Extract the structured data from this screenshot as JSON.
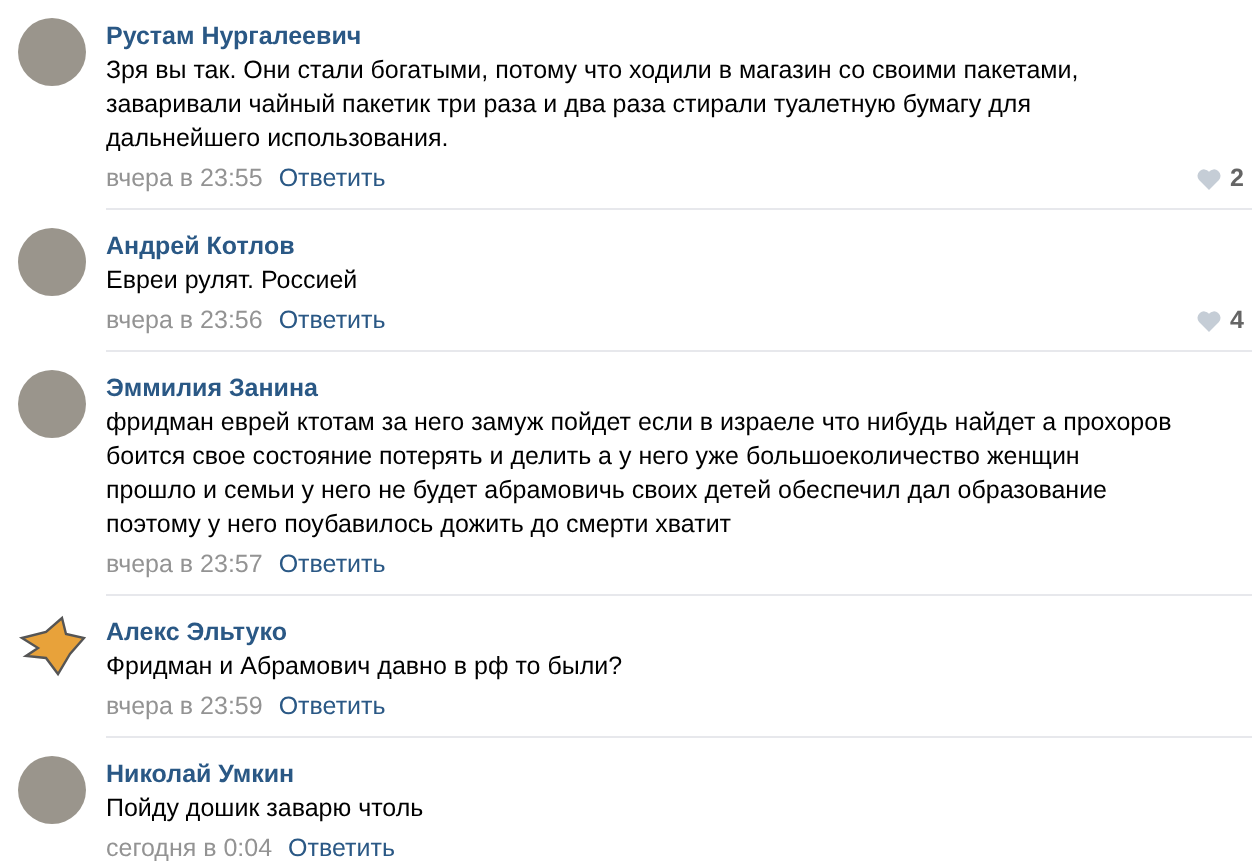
{
  "comments": [
    {
      "author": "Рустам Нургалеевич",
      "kind": "photo",
      "lines": [
        "Зря вы так. Они стали богатыми, потому что ходили в магазин со своими пакетами,",
        "заваривали чайный пакетик три раза и два раза стирали туалетную бумагу для",
        "дальнейшего использования."
      ],
      "time": "вчера в 23:55",
      "reply": "Ответить",
      "likes": "2"
    },
    {
      "author": "Андрей Котлов",
      "kind": "photo",
      "lines": [
        "Евреи рулят. Россией"
      ],
      "time": "вчера в 23:56",
      "reply": "Ответить",
      "likes": "4"
    },
    {
      "author": "Эммилия Занина",
      "kind": "photo",
      "lines": [
        "фридман еврей ктотам за него замуж пойдет если в израеле что нибудь найдет а прохоров",
        "боится свое состояние потерять и делить а у него уже большоеколичество женщин",
        "прошло и семьи у него не будет абрамовичь своих детей обеспечил дал образование",
        "поэтому у него поубавилось дожить до смерти хватит"
      ],
      "time": "вчера в 23:57",
      "reply": "Ответить"
    },
    {
      "author": "Алекс Эльтуко",
      "kind": "logo",
      "lines": [
        "Фридман и Абрамович давно в рф то были?"
      ],
      "time": "вчера в 23:59",
      "reply": "Ответить"
    },
    {
      "author": "Николай Умкин",
      "kind": "photo",
      "lines": [
        "Пойду дошик заварю чтоль"
      ],
      "time": "сегодня в 0:04",
      "reply": "Ответить"
    }
  ]
}
